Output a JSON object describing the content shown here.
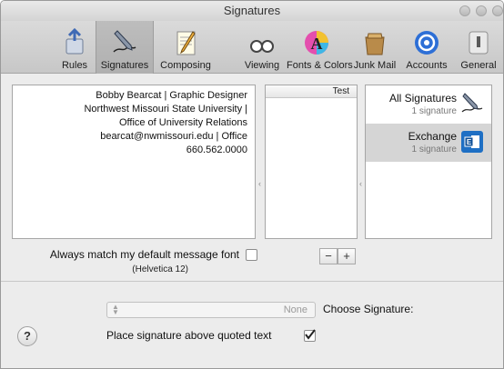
{
  "window": {
    "title": "Signatures"
  },
  "toolbar": {
    "items": [
      {
        "label": "General",
        "icon": "general-icon"
      },
      {
        "label": "Accounts",
        "icon": "accounts-icon"
      },
      {
        "label": "Junk Mail",
        "icon": "junk-mail-icon"
      },
      {
        "label": "Fonts & Colors",
        "icon": "fonts-colors-icon"
      },
      {
        "label": "Viewing",
        "icon": "viewing-icon"
      },
      {
        "label": "Composing",
        "icon": "composing-icon"
      },
      {
        "label": "Signatures",
        "icon": "signatures-icon",
        "selected": true
      },
      {
        "label": "Rules",
        "icon": "rules-icon"
      }
    ]
  },
  "accounts": [
    {
      "name": "All Signatures",
      "count": "1 signature",
      "icon": "pen-icon"
    },
    {
      "name": "Exchange",
      "count": "1 signature",
      "icon": "exchange-icon",
      "selected": true
    }
  ],
  "signatures": {
    "items": [
      "Test"
    ]
  },
  "signature_text": [
    "Bobby Bearcat  |  Graphic Designer",
    "Northwest Missouri State University  |",
    "Office of University Relations",
    "bearcat@nwmissouri.edu  |  Office",
    "660.562.0000"
  ],
  "buttons": {
    "add": "+",
    "remove": "−"
  },
  "font_option": {
    "label": "Always match my default message font",
    "sub": "(Helvetica 12)",
    "checked": false
  },
  "choose": {
    "label": "Choose Signature:",
    "value": "None"
  },
  "quote_option": {
    "label": "Place signature above quoted text",
    "checked": true
  },
  "help": {
    "label": "?"
  },
  "colors": {
    "selected_row": "#d5d5d5",
    "accent_blue": "#2d6fd6"
  }
}
